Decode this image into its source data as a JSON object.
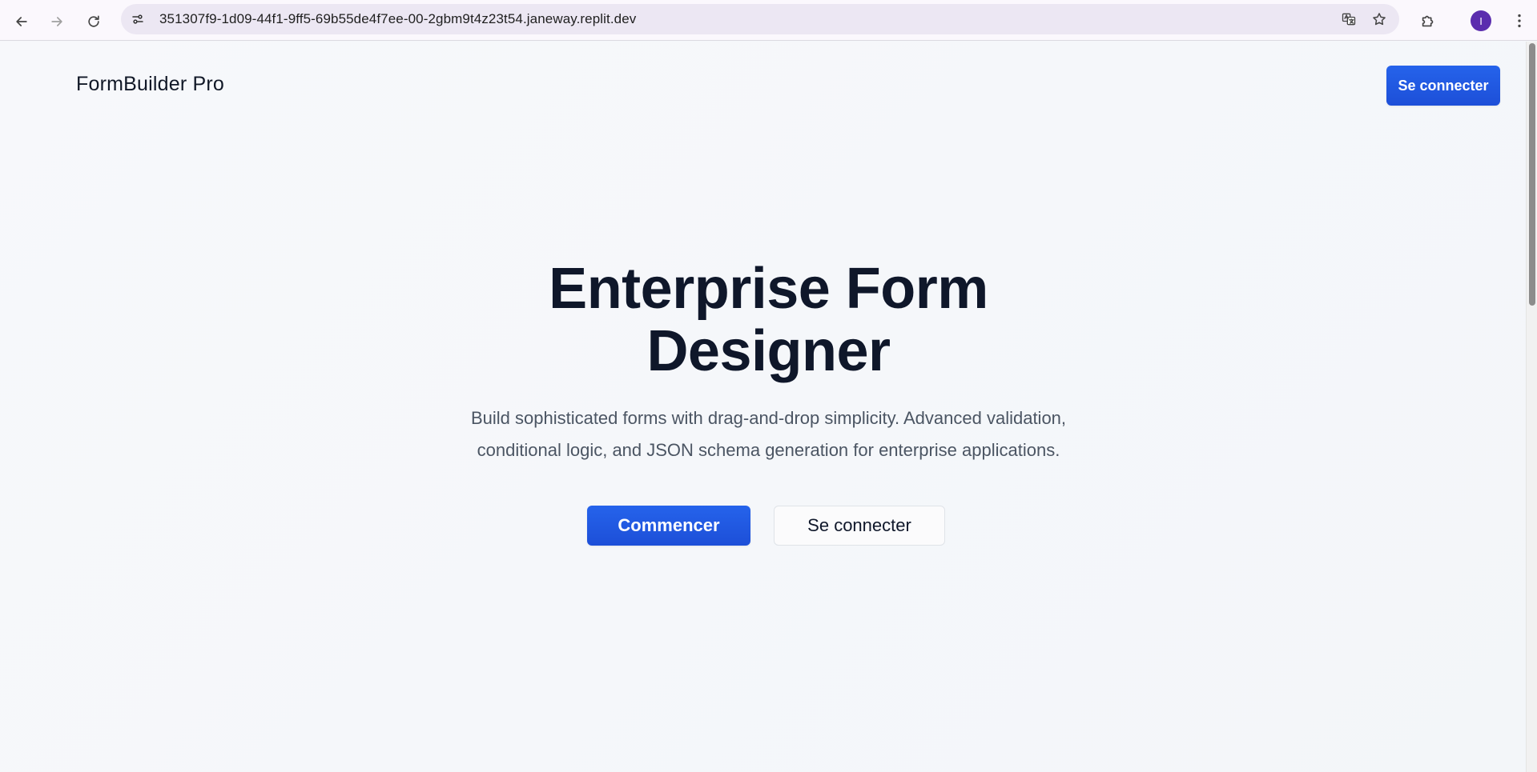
{
  "browser": {
    "url": "351307f9-1d09-44f1-9ff5-69b55de4f7ee-00-2gbm9t4z23t54.janeway.replit.dev",
    "profile_initial": "I",
    "profile_color": "#5b2dae"
  },
  "header": {
    "brand": "FormBuilder Pro",
    "login_label": "Se connecter"
  },
  "hero": {
    "title_line1": "Enterprise Form",
    "title_line2": "Designer",
    "subtitle_line1": "Build sophisticated forms with drag-and-drop simplicity. Advanced validation,",
    "subtitle_line2": "conditional logic, and JSON schema generation for enterprise applications.",
    "primary_cta": "Commencer",
    "secondary_cta": "Se connecter"
  },
  "colors": {
    "accent": "#2563eb",
    "title": "#0f172a",
    "body_text": "#4b5563",
    "background": "#f5f7fa"
  },
  "icons": {
    "back": "arrow-left-icon",
    "forward": "arrow-right-icon",
    "reload": "reload-icon",
    "site_info": "tune-icon",
    "translate": "translate-icon",
    "bookmark": "star-icon",
    "extensions": "puzzle-icon",
    "menu": "more-vertical-icon"
  }
}
